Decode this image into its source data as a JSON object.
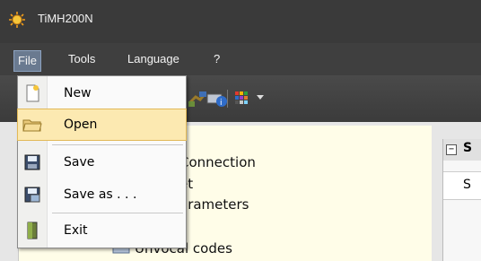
{
  "window": {
    "title": "TiMH200N",
    "icon": "app-sun-icon"
  },
  "menubar": {
    "items": [
      {
        "label": "File",
        "active": true
      },
      {
        "label": "Tools",
        "active": false
      },
      {
        "label": "Language",
        "active": false
      },
      {
        "label": "?",
        "active": false
      }
    ]
  },
  "toolbar": {
    "buttons": [
      "connect-icon",
      "info-icon",
      "palette-icon"
    ]
  },
  "file_menu": {
    "items": [
      {
        "label": "New",
        "icon": "new-file-icon",
        "highlighted": false
      },
      {
        "label": "Open",
        "icon": "open-folder-icon",
        "highlighted": true
      },
      {
        "label": "Save",
        "icon": "save-icon",
        "highlighted": false
      },
      {
        "label": "Save as . . .",
        "icon": "save-as-icon",
        "highlighted": false
      },
      {
        "label": "Exit",
        "icon": "exit-door-icon",
        "highlighted": false
      }
    ]
  },
  "tree": {
    "items": [
      "Connection",
      "et",
      "arameters",
      "Unvocal codes"
    ]
  },
  "side_panel": {
    "header": "S",
    "row": "S",
    "toggle": "−"
  }
}
